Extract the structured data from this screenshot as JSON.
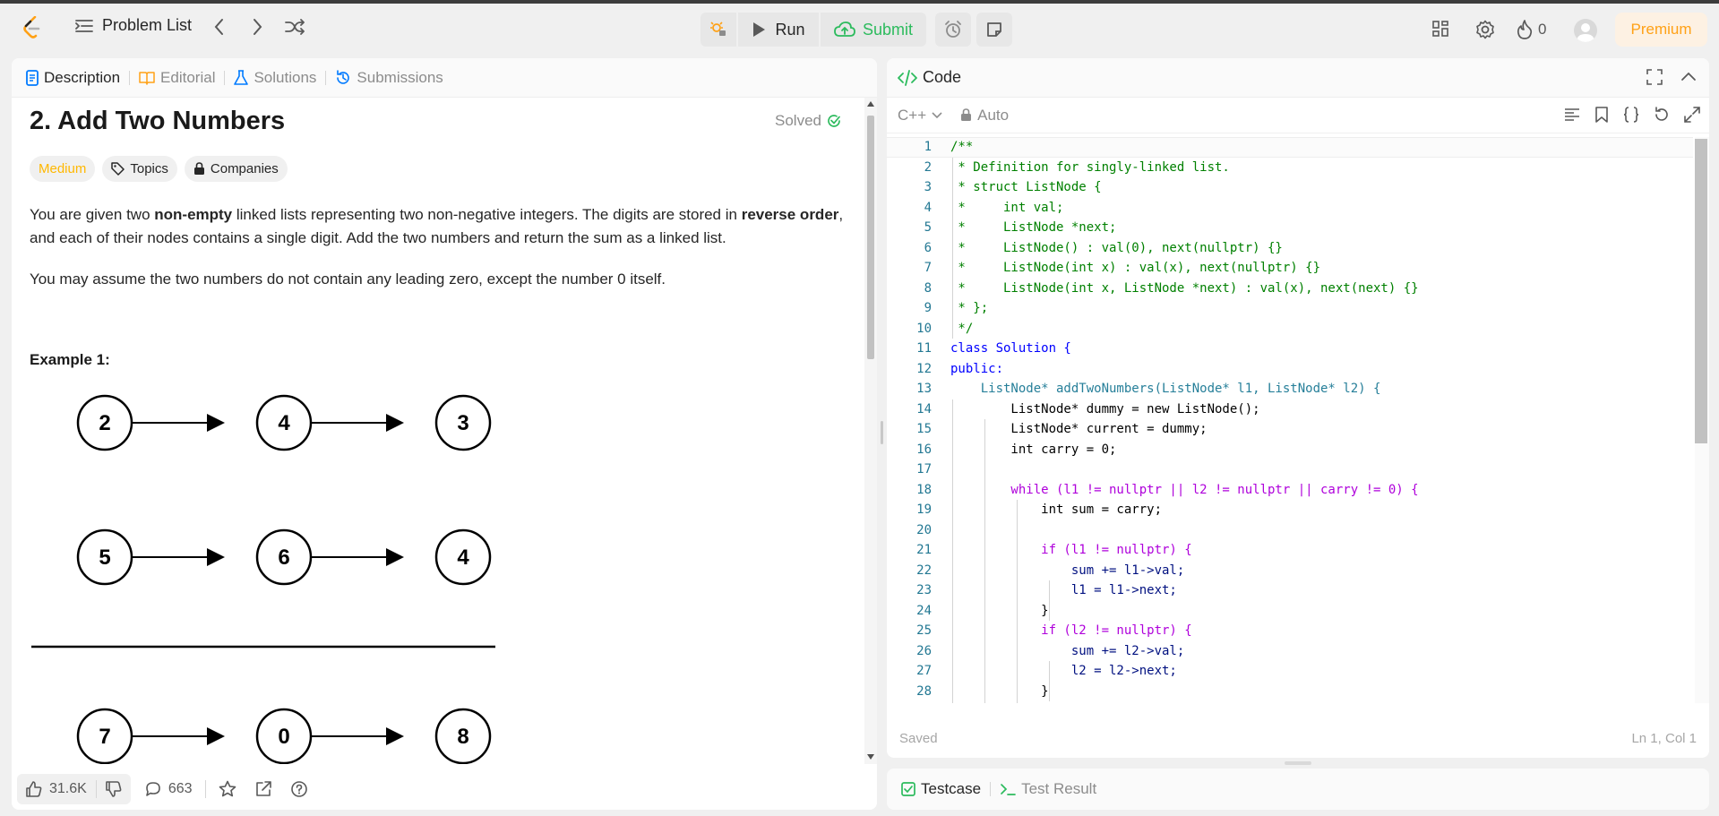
{
  "topbar": {
    "problem_list_label": "Problem List",
    "run_label": "Run",
    "submit_label": "Submit",
    "streak_count": "0",
    "premium_label": "Premium",
    "icons": [
      "leetcode-logo",
      "list-icon",
      "chevron-left-icon",
      "chevron-right-icon",
      "shuffle-icon",
      "debug-icon",
      "play-icon",
      "cloud-upload-icon",
      "alarm-icon",
      "note-icon",
      "layout-icon",
      "gear-icon",
      "fire-icon",
      "avatar"
    ]
  },
  "left_tabs": [
    "Description",
    "Editorial",
    "Solutions",
    "Submissions"
  ],
  "problem": {
    "title": "2. Add Two Numbers",
    "status": "Solved",
    "difficulty": "Medium",
    "topics_label": "Topics",
    "companies_label": "Companies",
    "paragraph1_parts": [
      "You are given two ",
      "non-empty",
      " linked lists representing two non-negative integers. The digits are stored in ",
      "reverse order",
      ", and each of their nodes contains a single digit. Add the two numbers and return the sum as a linked list."
    ],
    "paragraph2": "You may assume the two numbers do not contain any leading zero, except the number 0 itself.",
    "example_heading": "Example 1:",
    "diagram": {
      "list1": [
        "2",
        "4",
        "3"
      ],
      "list2": [
        "5",
        "6",
        "4"
      ],
      "result": [
        "7",
        "0",
        "8"
      ]
    }
  },
  "left_footer": {
    "likes": "31.6K",
    "comments": "663"
  },
  "code_panel": {
    "title": "Code",
    "language": "C++",
    "mode": "Auto",
    "status": "Saved",
    "cursor": "Ln 1, Col 1",
    "lines": [
      "/**",
      " * Definition for singly-linked list.",
      " * struct ListNode {",
      " *     int val;",
      " *     ListNode *next;",
      " *     ListNode() : val(0), next(nullptr) {}",
      " *     ListNode(int x) : val(x), next(nullptr) {}",
      " *     ListNode(int x, ListNode *next) : val(x), next(next) {}",
      " * };",
      " */",
      "class Solution {",
      "public:",
      "    ListNode* addTwoNumbers(ListNode* l1, ListNode* l2) {",
      "        ListNode* dummy = new ListNode();",
      "        ListNode* current = dummy;",
      "        int carry = 0;",
      "",
      "        while (l1 != nullptr || l2 != nullptr || carry != 0) {",
      "            int sum = carry;",
      "",
      "            if (l1 != nullptr) {",
      "                sum += l1->val;",
      "                l1 = l1->next;",
      "            }",
      "            if (l2 != nullptr) {",
      "                sum += l2->val;",
      "                l2 = l2->next;",
      "            }"
    ]
  },
  "bottom_tabs": [
    "Testcase",
    "Test Result"
  ],
  "colors": {
    "accent_green": "#2cbb5d",
    "difficulty_medium": "#ffb800",
    "premium": "#ffa116",
    "link_blue": "#007aff"
  }
}
